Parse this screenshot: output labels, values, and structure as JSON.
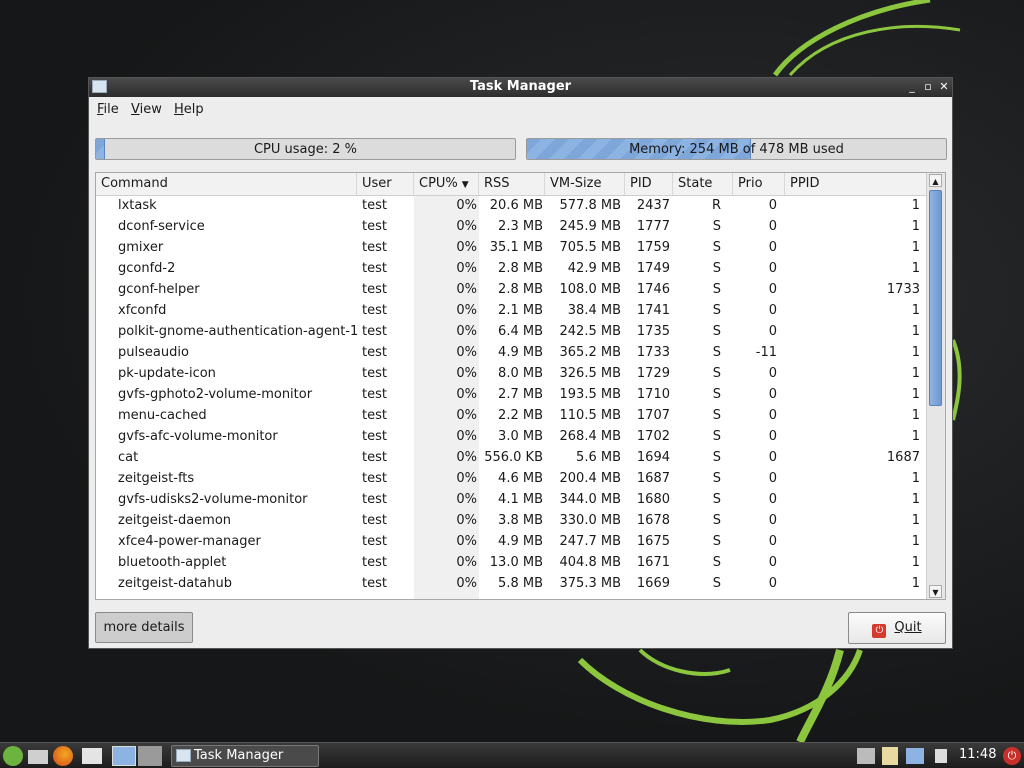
{
  "window": {
    "title": "Task Manager",
    "minimize": "_",
    "maximize": "▫",
    "close": "✕"
  },
  "menu": {
    "file": "File",
    "view": "View",
    "help": "Help"
  },
  "cpu": {
    "label": "CPU usage: 2 %",
    "percent": 2
  },
  "memory": {
    "label": "Memory: 254 MB of 478 MB used",
    "used_mb": 254,
    "total_mb": 478
  },
  "columns": {
    "command": "Command",
    "user": "User",
    "cpu": "CPU%",
    "rss": "RSS",
    "vmsize": "VM-Size",
    "pid": "PID",
    "state": "State",
    "prio": "Prio",
    "ppid": "PPID"
  },
  "processes": [
    {
      "command": "lxtask",
      "user": "test",
      "cpu": "0%",
      "rss": "20.6 MB",
      "vmsize": "577.8 MB",
      "pid": "2437",
      "state": "R",
      "prio": "0",
      "ppid": "1"
    },
    {
      "command": "dconf-service",
      "user": "test",
      "cpu": "0%",
      "rss": "2.3 MB",
      "vmsize": "245.9 MB",
      "pid": "1777",
      "state": "S",
      "prio": "0",
      "ppid": "1"
    },
    {
      "command": "gmixer",
      "user": "test",
      "cpu": "0%",
      "rss": "35.1 MB",
      "vmsize": "705.5 MB",
      "pid": "1759",
      "state": "S",
      "prio": "0",
      "ppid": "1"
    },
    {
      "command": "gconfd-2",
      "user": "test",
      "cpu": "0%",
      "rss": "2.8 MB",
      "vmsize": "42.9 MB",
      "pid": "1749",
      "state": "S",
      "prio": "0",
      "ppid": "1"
    },
    {
      "command": "gconf-helper",
      "user": "test",
      "cpu": "0%",
      "rss": "2.8 MB",
      "vmsize": "108.0 MB",
      "pid": "1746",
      "state": "S",
      "prio": "0",
      "ppid": "1733"
    },
    {
      "command": "xfconfd",
      "user": "test",
      "cpu": "0%",
      "rss": "2.1 MB",
      "vmsize": "38.4 MB",
      "pid": "1741",
      "state": "S",
      "prio": "0",
      "ppid": "1"
    },
    {
      "command": "polkit-gnome-authentication-agent-1",
      "user": "test",
      "cpu": "0%",
      "rss": "6.4 MB",
      "vmsize": "242.5 MB",
      "pid": "1735",
      "state": "S",
      "prio": "0",
      "ppid": "1"
    },
    {
      "command": "pulseaudio",
      "user": "test",
      "cpu": "0%",
      "rss": "4.9 MB",
      "vmsize": "365.2 MB",
      "pid": "1733",
      "state": "S",
      "prio": "-11",
      "ppid": "1"
    },
    {
      "command": "pk-update-icon",
      "user": "test",
      "cpu": "0%",
      "rss": "8.0 MB",
      "vmsize": "326.5 MB",
      "pid": "1729",
      "state": "S",
      "prio": "0",
      "ppid": "1"
    },
    {
      "command": "gvfs-gphoto2-volume-monitor",
      "user": "test",
      "cpu": "0%",
      "rss": "2.7 MB",
      "vmsize": "193.5 MB",
      "pid": "1710",
      "state": "S",
      "prio": "0",
      "ppid": "1"
    },
    {
      "command": "menu-cached",
      "user": "test",
      "cpu": "0%",
      "rss": "2.2 MB",
      "vmsize": "110.5 MB",
      "pid": "1707",
      "state": "S",
      "prio": "0",
      "ppid": "1"
    },
    {
      "command": "gvfs-afc-volume-monitor",
      "user": "test",
      "cpu": "0%",
      "rss": "3.0 MB",
      "vmsize": "268.4 MB",
      "pid": "1702",
      "state": "S",
      "prio": "0",
      "ppid": "1"
    },
    {
      "command": "cat",
      "user": "test",
      "cpu": "0%",
      "rss": "556.0 KB",
      "vmsize": "5.6 MB",
      "pid": "1694",
      "state": "S",
      "prio": "0",
      "ppid": "1687"
    },
    {
      "command": "zeitgeist-fts",
      "user": "test",
      "cpu": "0%",
      "rss": "4.6 MB",
      "vmsize": "200.4 MB",
      "pid": "1687",
      "state": "S",
      "prio": "0",
      "ppid": "1"
    },
    {
      "command": "gvfs-udisks2-volume-monitor",
      "user": "test",
      "cpu": "0%",
      "rss": "4.1 MB",
      "vmsize": "344.0 MB",
      "pid": "1680",
      "state": "S",
      "prio": "0",
      "ppid": "1"
    },
    {
      "command": "zeitgeist-daemon",
      "user": "test",
      "cpu": "0%",
      "rss": "3.8 MB",
      "vmsize": "330.0 MB",
      "pid": "1678",
      "state": "S",
      "prio": "0",
      "ppid": "1"
    },
    {
      "command": "xfce4-power-manager",
      "user": "test",
      "cpu": "0%",
      "rss": "4.9 MB",
      "vmsize": "247.7 MB",
      "pid": "1675",
      "state": "S",
      "prio": "0",
      "ppid": "1"
    },
    {
      "command": "bluetooth-applet",
      "user": "test",
      "cpu": "0%",
      "rss": "13.0 MB",
      "vmsize": "404.8 MB",
      "pid": "1671",
      "state": "S",
      "prio": "0",
      "ppid": "1"
    },
    {
      "command": "zeitgeist-datahub",
      "user": "test",
      "cpu": "0%",
      "rss": "5.8 MB",
      "vmsize": "375.3 MB",
      "pid": "1669",
      "state": "S",
      "prio": "0",
      "ppid": "1"
    }
  ],
  "buttons": {
    "details": "more details",
    "quit": "Quit"
  },
  "taskbar": {
    "task_label": "Task Manager",
    "clock": "11:48",
    "icons": [
      "menu-icon",
      "folder-icon",
      "firefox-icon",
      "windows-icon",
      "desktop-icon",
      "blank-icon"
    ]
  },
  "colors": {
    "accent": "#7ea6d8",
    "swirl": "#8cc63f"
  }
}
